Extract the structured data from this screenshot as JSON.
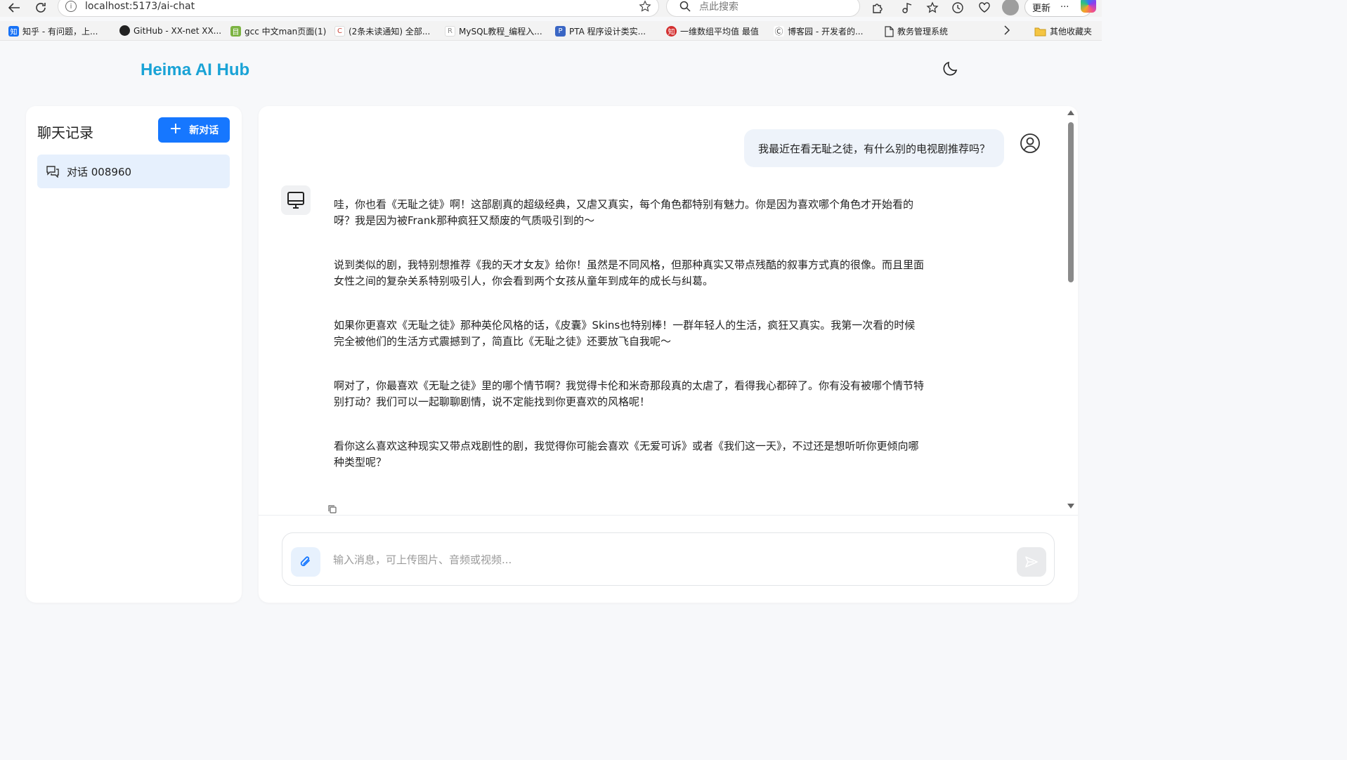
{
  "browser": {
    "url": "localhost:5173/ai-chat",
    "search_placeholder": "点此搜索",
    "update_label": "更新",
    "more_label": "···",
    "bookmarks": [
      {
        "label": "知乎 - 有问题，上...",
        "icon": "zhihu-icon",
        "color": "#1772f6",
        "glyph": "知"
      },
      {
        "label": "GitHub - XX-net XX...",
        "icon": "github-icon",
        "color": "#222222",
        "glyph": "●"
      },
      {
        "label": "gcc 中文man页面(1)",
        "icon": "page-icon",
        "color": "#7cb342",
        "glyph": "目"
      },
      {
        "label": "(2条未读通知) 全部...",
        "icon": "csdn-icon",
        "color": "#c9473d",
        "glyph": "C"
      },
      {
        "label": "MySQL教程_编程入...",
        "icon": "runoob-icon",
        "color": "#b5b5b5",
        "glyph": "R"
      },
      {
        "label": "PTA  程序设计类实...",
        "icon": "pta-icon",
        "color": "#3a66c4",
        "glyph": "P"
      },
      {
        "label": "一维数组平均值 最值",
        "icon": "site-icon",
        "color": "#d32f2f",
        "glyph": "知"
      },
      {
        "label": "博客园 - 开发者的...",
        "icon": "cnblogs-icon",
        "color": "#555555",
        "glyph": "Ⓒ"
      },
      {
        "label": "教务管理系统",
        "icon": "document-icon",
        "color": "#ffffff",
        "glyph": ""
      }
    ],
    "other_bookmarks": "其他收藏夹"
  },
  "app": {
    "title": "Heima AI Hub"
  },
  "sidebar": {
    "title": "聊天记录",
    "new_chat_label": "新对话",
    "conversations": [
      {
        "label": "对话 008960"
      }
    ]
  },
  "chat": {
    "user_message": "我最近在看无耻之徒，有什么别的电视剧推荐吗？",
    "bot_paragraphs": [
      "哇，你也看《无耻之徒》啊！这部剧真的超级经典，又虐又真实，每个角色都特别有魅力。你是因为喜欢哪个角色才开始看的呀？我是因为被Frank那种疯狂又颓废的气质吸引到的～",
      "说到类似的剧，我特别想推荐《我的天才女友》给你！虽然是不同风格，但那种真实又带点残酷的叙事方式真的很像。而且里面女性之间的复杂关系特别吸引人，你会看到两个女孩从童年到成年的成长与纠葛。",
      "如果你更喜欢《无耻之徒》那种英伦风格的话，《皮囊》Skins也特别棒！一群年轻人的生活，疯狂又真实。我第一次看的时候完全被他们的生活方式震撼到了，简直比《无耻之徒》还要放飞自我呢～",
      "啊对了，你最喜欢《无耻之徒》里的哪个情节啊？我觉得卡伦和米奇那段真的太虐了，看得我心都碎了。你有没有被哪个情节特别打动？我们可以一起聊聊剧情，说不定能找到你更喜欢的风格呢！",
      "看你这么喜欢这种现实又带点戏剧性的剧，我觉得你可能会喜欢《无爱可诉》或者《我们这一天》，不过还是想听听你更倾向哪种类型呢？"
    ],
    "input_placeholder": "输入消息，可上传图片、音频或视频...",
    "input_value": ""
  },
  "colors": {
    "accent": "#1677ff",
    "title": "#1aa3d6",
    "conversation_active_bg": "#e6f0fd",
    "user_bubble_bg": "#eef3fa"
  }
}
